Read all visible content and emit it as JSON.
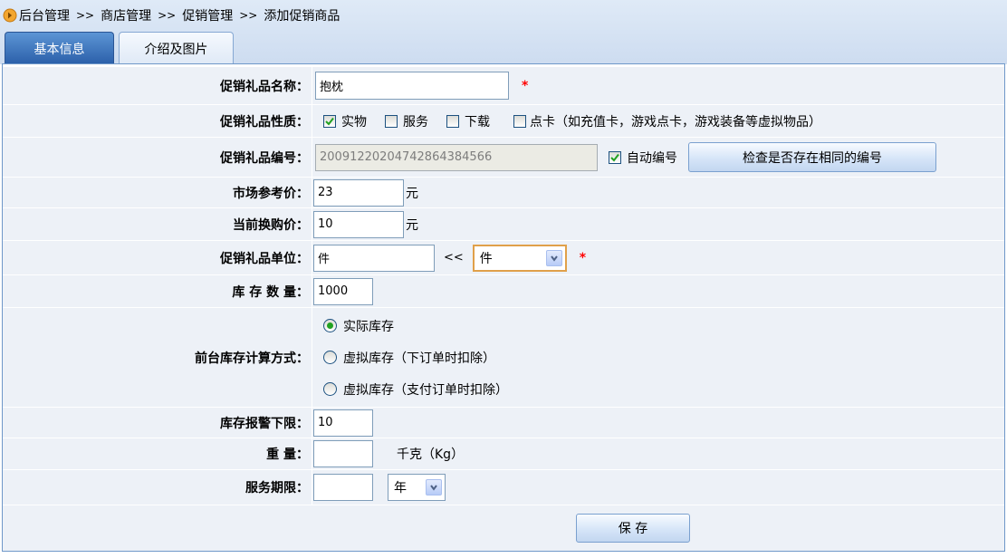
{
  "breadcrumb": {
    "icon": "arrow-right-circle-icon",
    "items": [
      "后台管理",
      "商店管理",
      "促销管理",
      "添加促销商品"
    ],
    "separator": ">>"
  },
  "tabs": [
    {
      "label": "基本信息",
      "active": true
    },
    {
      "label": "介绍及图片",
      "active": false
    }
  ],
  "form": {
    "gift_name": {
      "label": "促销礼品名称：",
      "value": "抱枕",
      "required": "*"
    },
    "gift_nature": {
      "label": "促销礼品性质：",
      "options": [
        {
          "label": "实物",
          "checked": true
        },
        {
          "label": "服务",
          "checked": false
        },
        {
          "label": "下载",
          "checked": false
        },
        {
          "label": "点卡（如充值卡，游戏点卡，游戏装备等虚拟物品）",
          "checked": false
        }
      ]
    },
    "gift_code": {
      "label": "促销礼品编号：",
      "value": "20091220204742864384566",
      "disabled": true,
      "auto_code": {
        "label": "自动编号",
        "checked": true
      },
      "check_button": "检查是否存在相同的编号"
    },
    "market_price": {
      "label": "市场参考价：",
      "value": "23",
      "unit": "元"
    },
    "exchange_price": {
      "label": "当前换购价：",
      "value": "10",
      "unit": "元"
    },
    "gift_unit": {
      "label": "促销礼品单位：",
      "value": "件",
      "copy_arrow": "<<",
      "select_value": "件",
      "required": "*"
    },
    "stock_qty": {
      "label": "库 存 数 量：",
      "value": "1000"
    },
    "stock_calc": {
      "label": "前台库存计算方式：",
      "options": [
        {
          "label": "实际库存",
          "selected": true
        },
        {
          "label": "虚拟库存（下订单时扣除）",
          "selected": false
        },
        {
          "label": "虚拟库存（支付订单时扣除）",
          "selected": false
        }
      ]
    },
    "stock_alert": {
      "label": "库存报警下限：",
      "value": "10"
    },
    "weight": {
      "label": "重 量：",
      "value": "",
      "unit": "千克（Kg）"
    },
    "service_period": {
      "label": "服务期限：",
      "value": "",
      "select_value": "年"
    }
  },
  "save_button": "保 存",
  "colors": {
    "header_bg": "#d8e5f5",
    "active_tab": "#2d63ad",
    "border": "#6f98c9",
    "row_bg": "#edf1f7",
    "required": "#ff0000",
    "check": "#21a121",
    "focus_border": "#e0a04a"
  }
}
